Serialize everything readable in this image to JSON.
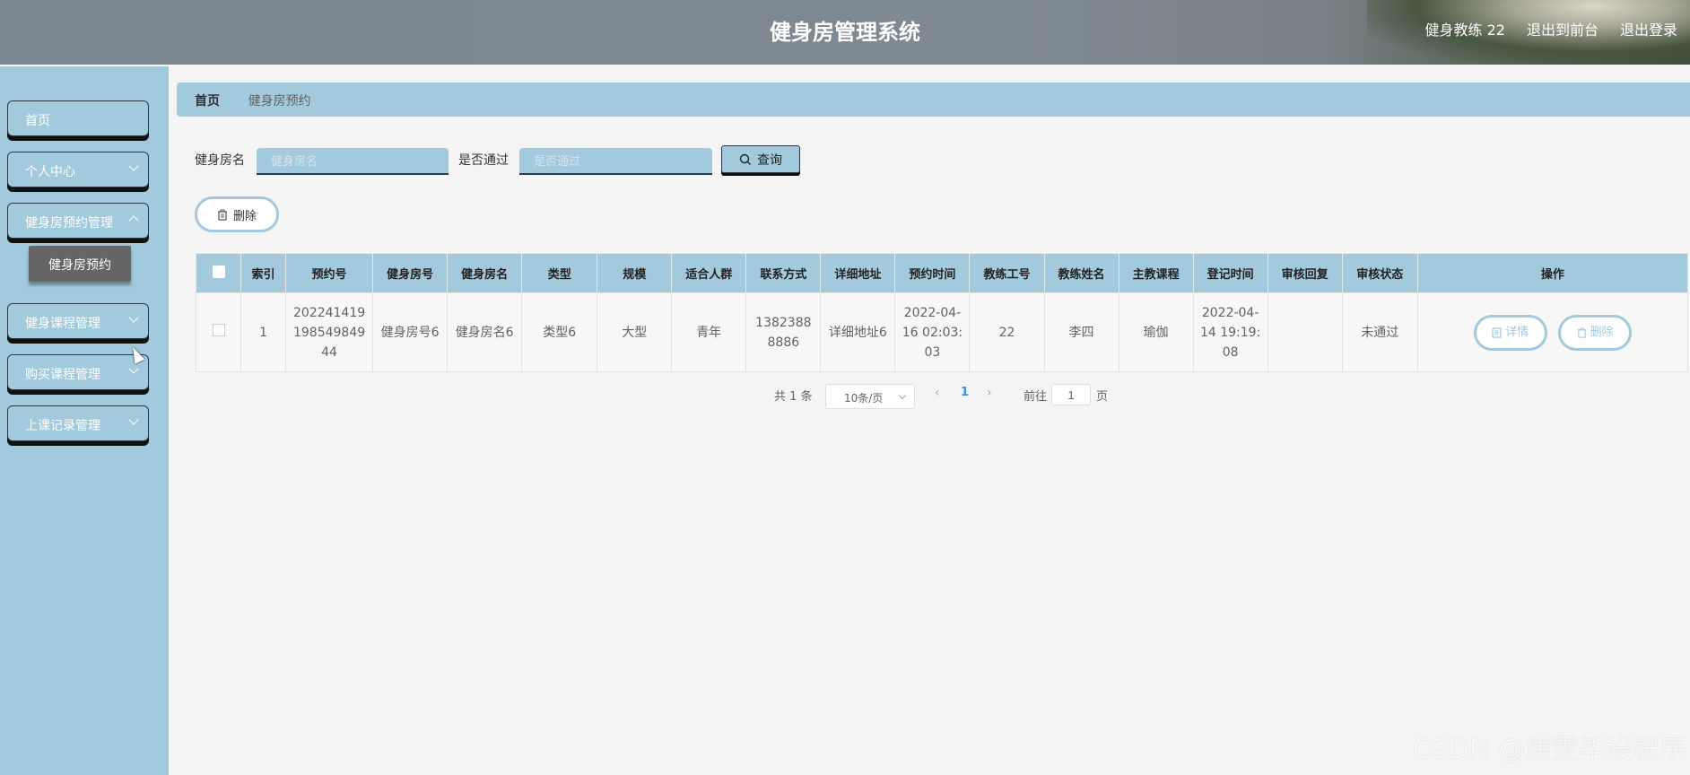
{
  "header": {
    "title": "健身房管理系统",
    "user_label": "健身教练 22",
    "back_front_label": "退出到前台",
    "logout_label": "退出登录"
  },
  "sidebar": {
    "items": [
      {
        "label": "首页"
      },
      {
        "label": "个人中心"
      },
      {
        "label": "健身房预约管理"
      },
      {
        "label": "健身课程管理"
      },
      {
        "label": "购买课程管理"
      },
      {
        "label": "上课记录管理"
      }
    ],
    "active_sub_item": "健身房预约"
  },
  "breadcrumb": {
    "home": "首页",
    "separator": "/",
    "current": "健身房预约"
  },
  "search": {
    "name_label": "健身房名",
    "name_placeholder": "健身房名",
    "pass_label": "是否通过",
    "pass_placeholder": "是否通过",
    "button_label": "查询"
  },
  "toolbar": {
    "delete_label": "删除"
  },
  "table": {
    "columns": [
      "索引",
      "预约号",
      "健身房号",
      "健身房名",
      "类型",
      "规模",
      "适合人群",
      "联系方式",
      "详细地址",
      "预约时间",
      "教练工号",
      "教练姓名",
      "主教课程",
      "登记时间",
      "审核回复",
      "审核状态",
      "操作"
    ],
    "rows": [
      {
        "index": "1",
        "booking_no": "202241419198549849 44",
        "gym_no": "健身房号6",
        "gym_name": "健身房名6",
        "type": "类型6",
        "scale": "大型",
        "audience": "青年",
        "contact": "13823888886",
        "address": "详细地址6",
        "booking_time": "2022-04-16 02:03:03",
        "coach_id": "22",
        "coach_name": "李四",
        "course": "瑜伽",
        "register_time": "2022-04-14 19:19:08",
        "review_reply": "",
        "review_status": "未通过",
        "detail_label": "详情",
        "delete_label": "删除"
      }
    ]
  },
  "pagination": {
    "total_text": "共 1 条",
    "page_size": "10条/页",
    "current_page": "1",
    "goto_label": "前往",
    "goto_value": "1",
    "page_suffix": "页"
  },
  "watermark": "CSDN @唐雯毕设程序"
}
